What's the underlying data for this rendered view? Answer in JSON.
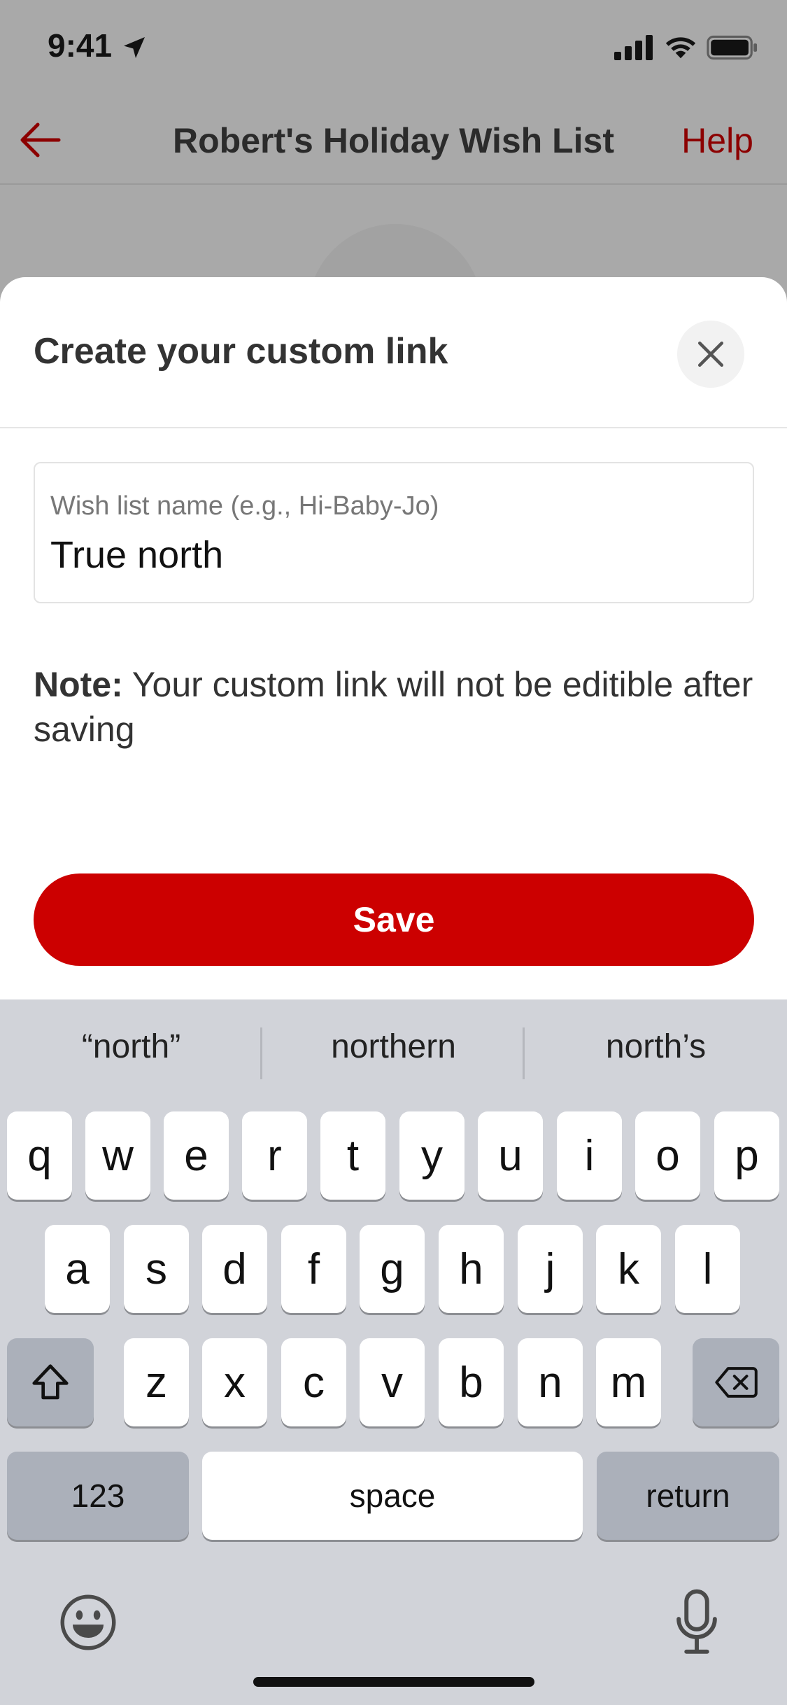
{
  "status_bar": {
    "time": "9:41",
    "icons": [
      "location-arrow-icon",
      "cellular-signal-icon",
      "wifi-icon",
      "battery-icon"
    ]
  },
  "nav": {
    "back_icon": "arrow-left-icon",
    "title": "Robert's Holiday Wish List",
    "help_label": "Help",
    "accent_color": "#8c0000"
  },
  "sheet": {
    "title": "Create your custom link",
    "close_icon": "close-icon",
    "field": {
      "label": "Wish list name (e.g., Hi-Baby-Jo)",
      "value": "True north"
    },
    "note_bold": "Note:",
    "note_text": " Your custom link will not be editible after saving",
    "save_label": "Save",
    "save_color": "#cc0000"
  },
  "keyboard": {
    "suggestions": [
      "“north”",
      "northern",
      "north’s"
    ],
    "row1": [
      "q",
      "w",
      "e",
      "r",
      "t",
      "y",
      "u",
      "i",
      "o",
      "p"
    ],
    "row2": [
      "a",
      "s",
      "d",
      "f",
      "g",
      "h",
      "j",
      "k",
      "l"
    ],
    "row3": [
      "z",
      "x",
      "c",
      "v",
      "b",
      "n",
      "m"
    ],
    "shift_icon": "shift-arrow-icon",
    "delete_icon": "backspace-icon",
    "numbers_label": "123",
    "space_label": "space",
    "return_label": "return",
    "emoji_icon": "emoji-icon",
    "mic_icon": "microphone-icon"
  }
}
